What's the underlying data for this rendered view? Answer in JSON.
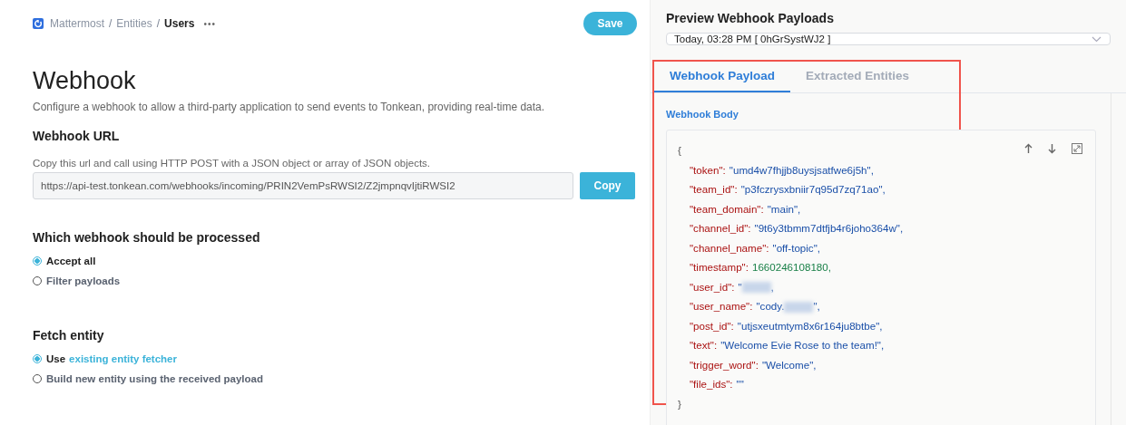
{
  "breadcrumb": {
    "items": [
      "Mattermost",
      "Entities",
      "Users"
    ],
    "separator": "/",
    "more": "•••"
  },
  "save_button": "Save",
  "page": {
    "title": "Webhook",
    "description": "Configure a webhook to allow a third-party application to send events to Tonkean, providing real-time data."
  },
  "webhook_url": {
    "heading": "Webhook URL",
    "hint": "Copy this url and call using HTTP POST with a JSON object or array of JSON objects.",
    "value": "https://api-test.tonkean.com/webhooks/incoming/PRIN2VemPsRWSI2/Z2jmpnqvIjtiRWSI2",
    "button": "Copy"
  },
  "sections": [
    {
      "heading": "Which webhook should be processed",
      "options": [
        {
          "label": "Accept all",
          "selected": true
        },
        {
          "label": "Filter payloads",
          "selected": false
        }
      ]
    },
    {
      "heading": "Fetch entity",
      "options": [
        {
          "label": "Use",
          "link": "existing entity fetcher",
          "selected": true
        },
        {
          "label": "Build new entity using the received payload",
          "selected": false
        }
      ]
    }
  ],
  "preview": {
    "title": "Preview Webhook Payloads",
    "dropdown_value": "Today, 03:28 PM [ 0hGrSystWJ2 ]",
    "tabs": [
      {
        "label": "Webhook Payload",
        "selected": true
      },
      {
        "label": "Extracted Entities",
        "selected": false
      }
    ],
    "highlighted": true,
    "body_label": "Webhook Body",
    "json_open": "{",
    "json_close": "}",
    "lines": [
      {
        "key": "\"token\":",
        "value": "\"umd4w7fhjjb8uysjsatfwe6j5h\",",
        "kind": "string"
      },
      {
        "key": "\"team_id\":",
        "value": "\"p3fczrysxbniir7q95d7zq71ao\",",
        "kind": "string"
      },
      {
        "key": "\"team_domain\":",
        "value": "\"main\",",
        "kind": "string"
      },
      {
        "key": "\"channel_id\":",
        "value": "\"9t6y3tbmm7dtfjb4r6joho364w\",",
        "kind": "string"
      },
      {
        "key": "\"channel_name\":",
        "value": "\"off-topic\",",
        "kind": "string"
      },
      {
        "key": "\"timestamp\":",
        "value": "1660246108180,",
        "kind": "number"
      },
      {
        "key": "\"user_id\":",
        "value": "\"",
        "kind": "string",
        "redacted": true,
        "tail": ","
      },
      {
        "key": "\"user_name\":",
        "value": "\"cody.",
        "kind": "string",
        "redacted": true,
        "tail": "\","
      },
      {
        "key": "\"post_id\":",
        "value": "\"utjsxeutmtym8x6r164ju8btbe\",",
        "kind": "string"
      },
      {
        "key": "\"text\":",
        "value": "\"Welcome Evie Rose to the team!\",",
        "kind": "string"
      },
      {
        "key": "\"trigger_word\":",
        "value": "\"Welcome\",",
        "kind": "string"
      },
      {
        "key": "\"file_ids\":",
        "value": "\"\"",
        "kind": "string"
      }
    ]
  }
}
